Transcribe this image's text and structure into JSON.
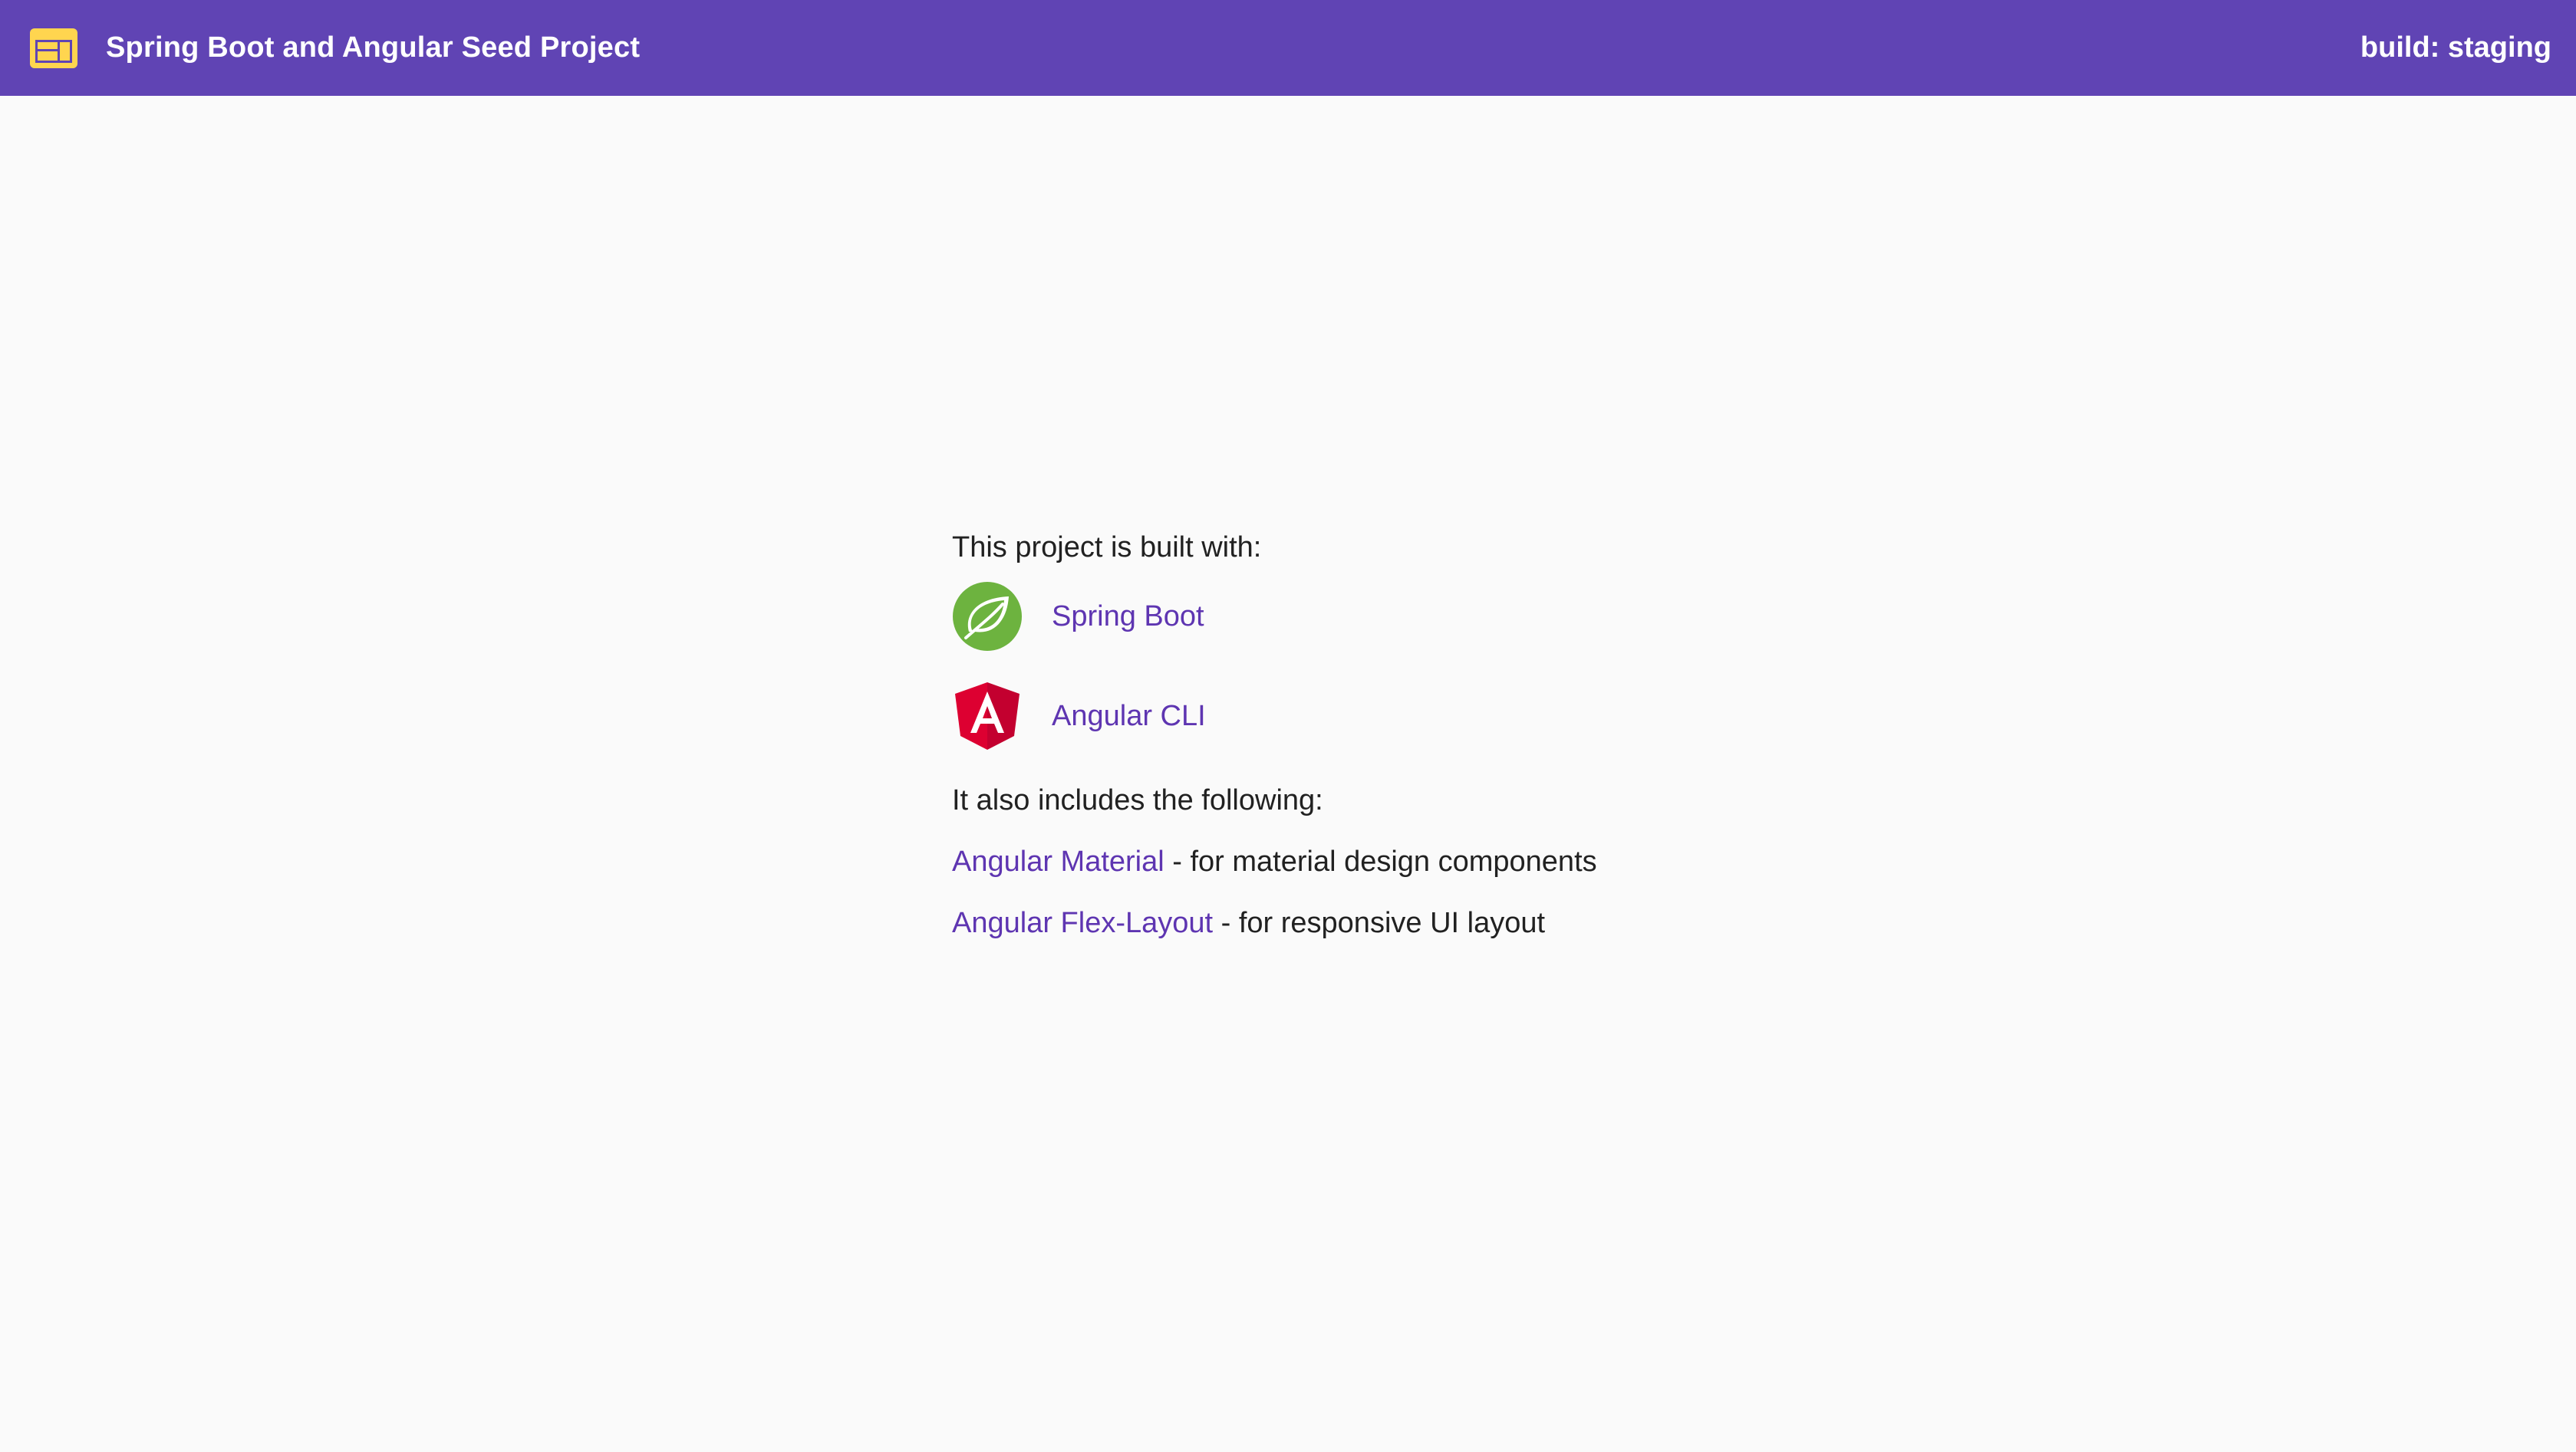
{
  "header": {
    "title": "Spring Boot and Angular Seed Project",
    "build_label": "build: staging",
    "icon": "web-layout-icon",
    "background_color": "#6044b4",
    "icon_color": "#ffd54f"
  },
  "main": {
    "built_with_label": "This project is built with:",
    "technologies": [
      {
        "label": "Spring Boot",
        "icon": "spring-boot-logo-icon"
      },
      {
        "label": "Angular CLI",
        "icon": "angular-logo-icon"
      }
    ],
    "includes_label": "It also includes the following:",
    "includes": [
      {
        "link": "Angular Material",
        "description": "- for material design components"
      },
      {
        "link": "Angular Flex-Layout",
        "description": "- for responsive UI layout"
      }
    ],
    "link_color": "#5e35b1"
  }
}
